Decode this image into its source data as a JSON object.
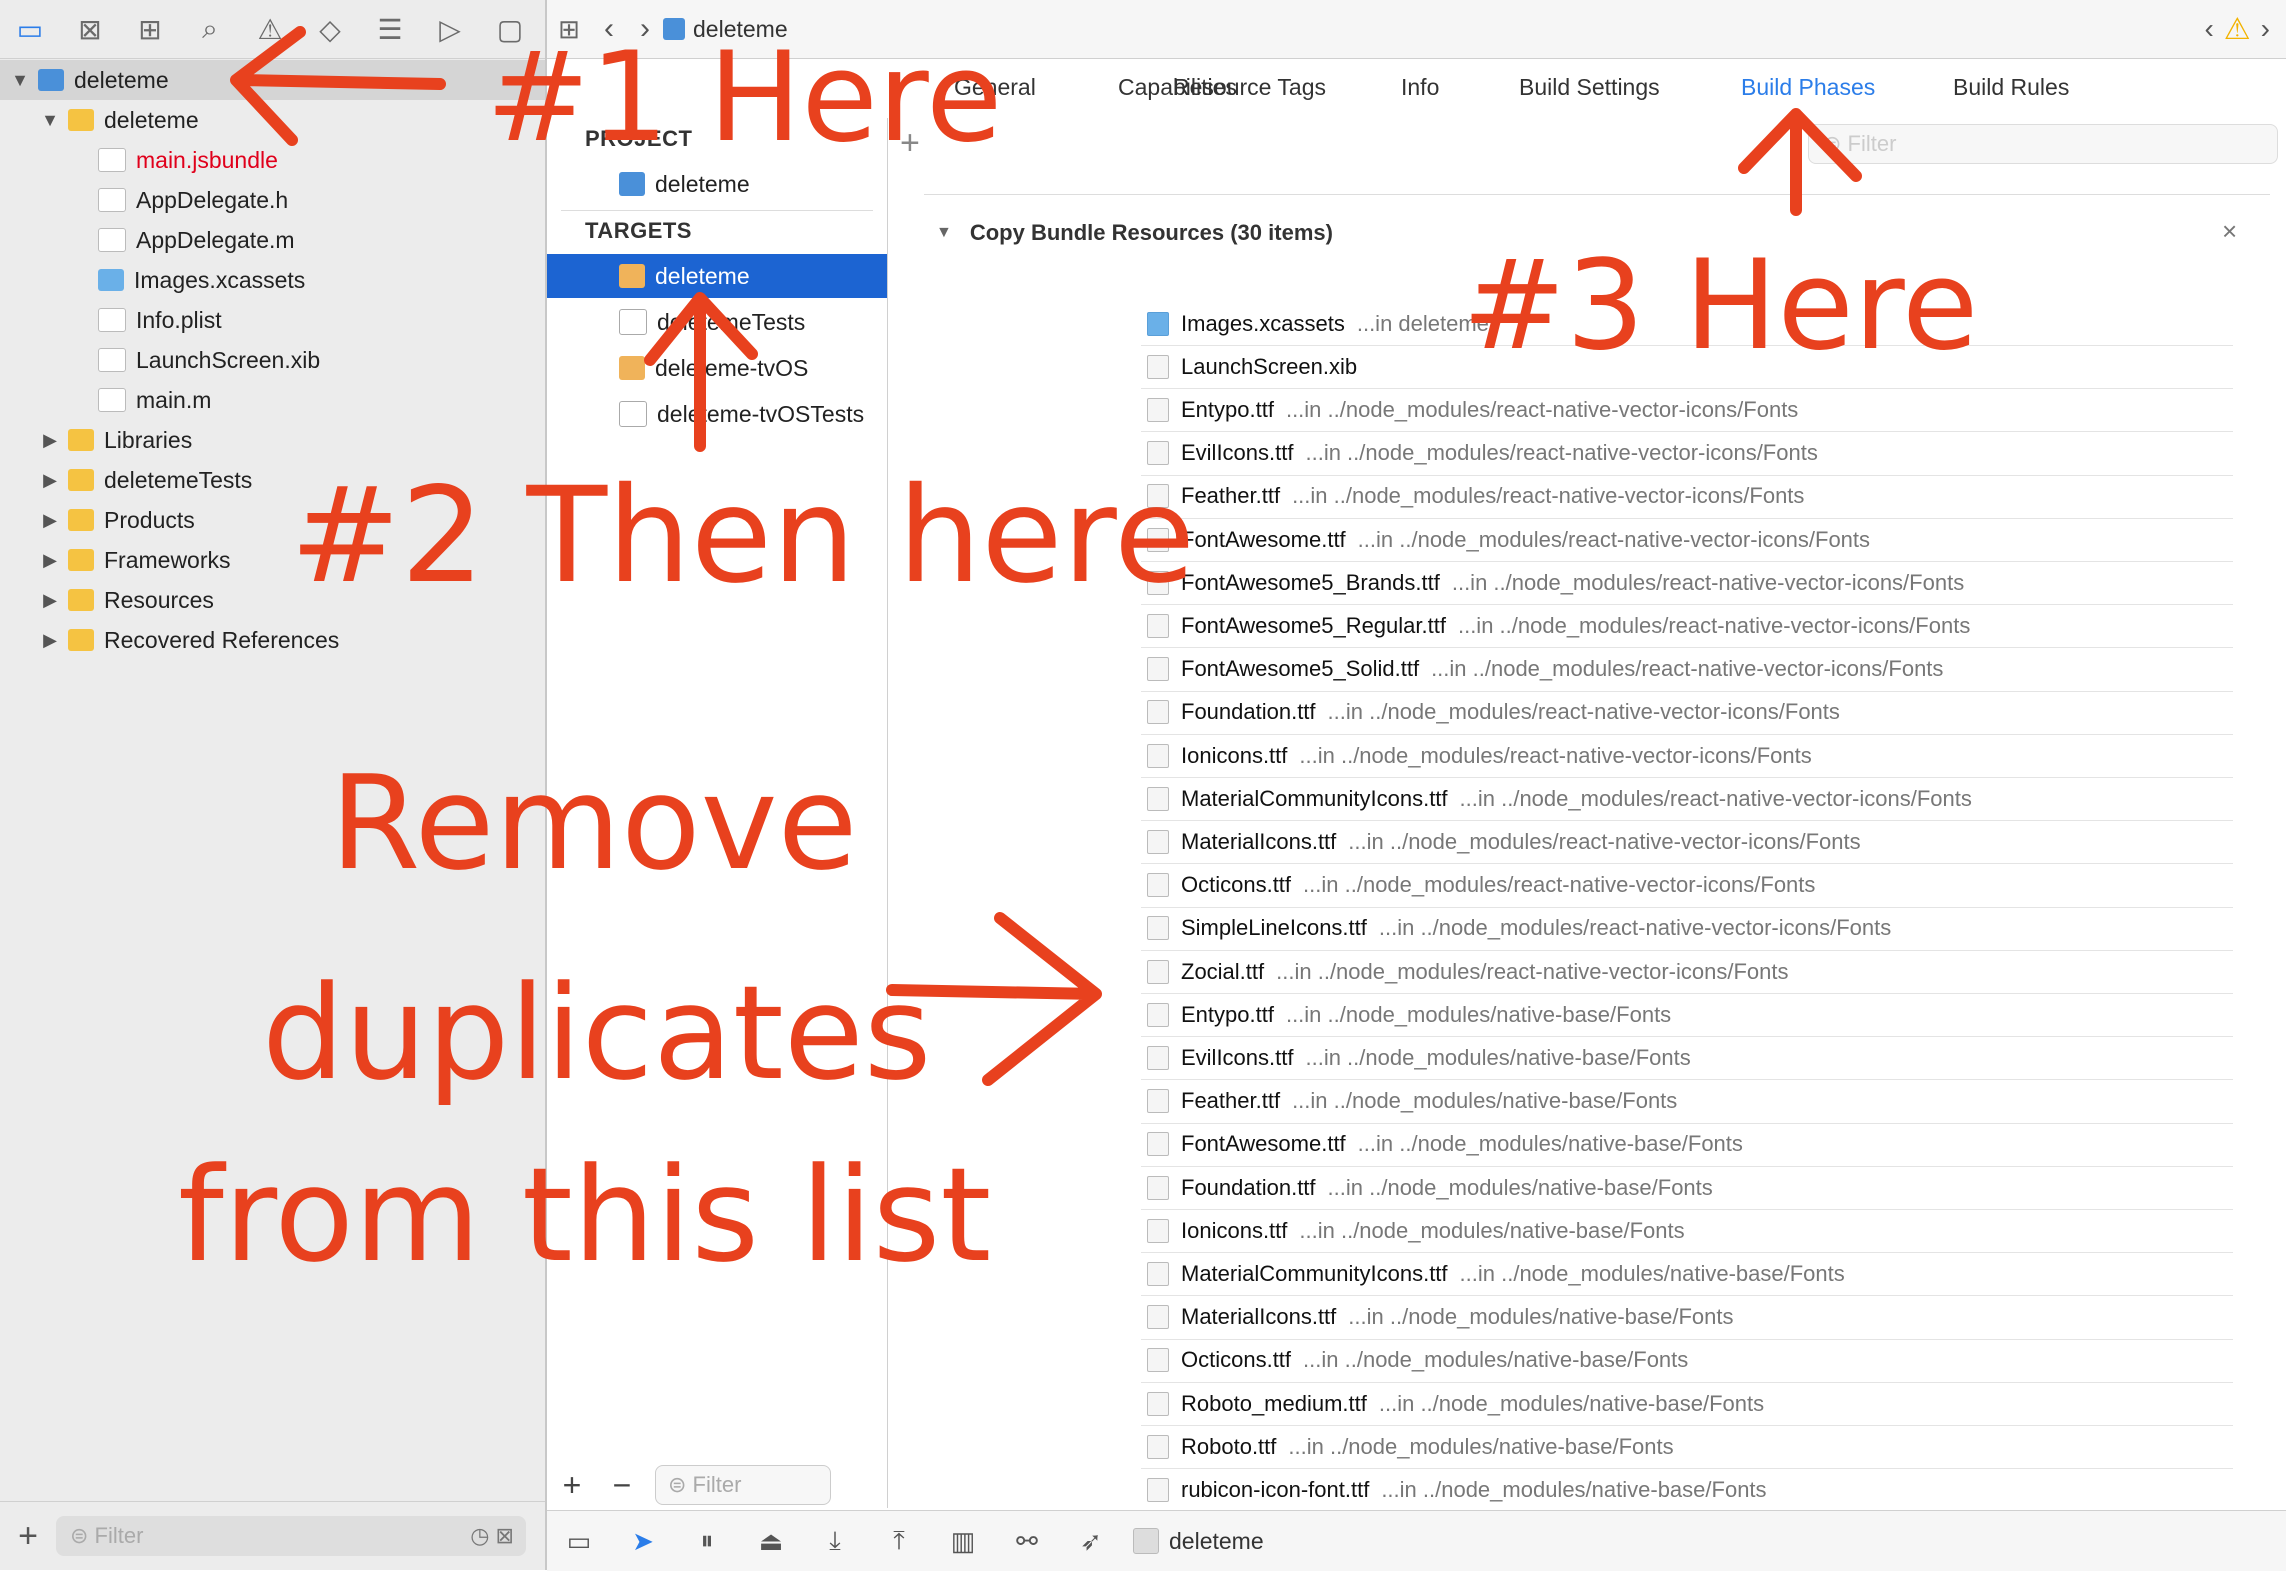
{
  "navigator": {
    "toolbar_icons": [
      "folder-icon",
      "x-square-icon",
      "hierarchy-icon",
      "search-icon",
      "warning-icon",
      "diamond-icon",
      "list-icon",
      "tag-icon",
      "comment-icon"
    ],
    "tree": [
      {
        "label": "deleteme",
        "kind": "project",
        "depth": 0,
        "disclosure": "▼",
        "selected": true
      },
      {
        "label": "deleteme",
        "kind": "folder",
        "depth": 1,
        "disclosure": "▼"
      },
      {
        "label": "main.jsbundle",
        "kind": "doc",
        "depth": 2,
        "disclosure": "",
        "red": true
      },
      {
        "label": "AppDelegate.h",
        "kind": "doc",
        "depth": 2,
        "disclosure": ""
      },
      {
        "label": "AppDelegate.m",
        "kind": "doc",
        "depth": 2,
        "disclosure": ""
      },
      {
        "label": "Images.xcassets",
        "kind": "assets",
        "depth": 2,
        "disclosure": ""
      },
      {
        "label": "Info.plist",
        "kind": "doc",
        "depth": 2,
        "disclosure": ""
      },
      {
        "label": "LaunchScreen.xib",
        "kind": "doc",
        "depth": 2,
        "disclosure": ""
      },
      {
        "label": "main.m",
        "kind": "doc",
        "depth": 2,
        "disclosure": ""
      },
      {
        "label": "Libraries",
        "kind": "folder",
        "depth": 1,
        "disclosure": "▶"
      },
      {
        "label": "deletemeTests",
        "kind": "folder",
        "depth": 1,
        "disclosure": "▶"
      },
      {
        "label": "Products",
        "kind": "folder",
        "depth": 1,
        "disclosure": "▶"
      },
      {
        "label": "Frameworks",
        "kind": "folder",
        "depth": 1,
        "disclosure": "▶"
      },
      {
        "label": "Resources",
        "kind": "folder",
        "depth": 1,
        "disclosure": "▶"
      },
      {
        "label": "Recovered References",
        "kind": "folder",
        "depth": 1,
        "disclosure": "▶"
      }
    ],
    "filter_placeholder": "Filter"
  },
  "editor": {
    "breadcrumb": "deleteme",
    "tabs": [
      "General",
      "Capabilities",
      "Resource Tags",
      "Info",
      "Build Settings",
      "Build Phases",
      "Build Rules"
    ],
    "active_tab": "Build Phases",
    "project_header": "PROJECT",
    "project_item": "deleteme",
    "targets_header": "TARGETS",
    "targets": [
      "deleteme",
      "deletemeTests",
      "deleteme-tvOS",
      "deleteme-tvOSTests"
    ],
    "selected_target": "deleteme",
    "filter_placeholder": "Filter",
    "list_filter_placeholder": "Filter"
  },
  "phase": {
    "title": "Copy Bundle Resources (30 items)",
    "resources": [
      {
        "name": "Images.xcassets",
        "loc": "...in deleteme",
        "folder": true
      },
      {
        "name": "LaunchScreen.xib",
        "loc": ""
      },
      {
        "name": "Entypo.ttf",
        "loc": "...in ../node_modules/react-native-vector-icons/Fonts"
      },
      {
        "name": "EvilIcons.ttf",
        "loc": "...in ../node_modules/react-native-vector-icons/Fonts"
      },
      {
        "name": "Feather.ttf",
        "loc": "...in ../node_modules/react-native-vector-icons/Fonts"
      },
      {
        "name": "FontAwesome.ttf",
        "loc": "...in ../node_modules/react-native-vector-icons/Fonts"
      },
      {
        "name": "FontAwesome5_Brands.ttf",
        "loc": "...in ../node_modules/react-native-vector-icons/Fonts"
      },
      {
        "name": "FontAwesome5_Regular.ttf",
        "loc": "...in ../node_modules/react-native-vector-icons/Fonts"
      },
      {
        "name": "FontAwesome5_Solid.ttf",
        "loc": "...in ../node_modules/react-native-vector-icons/Fonts"
      },
      {
        "name": "Foundation.ttf",
        "loc": "...in ../node_modules/react-native-vector-icons/Fonts"
      },
      {
        "name": "Ionicons.ttf",
        "loc": "...in ../node_modules/react-native-vector-icons/Fonts"
      },
      {
        "name": "MaterialCommunityIcons.ttf",
        "loc": "...in ../node_modules/react-native-vector-icons/Fonts"
      },
      {
        "name": "MaterialIcons.ttf",
        "loc": "...in ../node_modules/react-native-vector-icons/Fonts"
      },
      {
        "name": "Octicons.ttf",
        "loc": "...in ../node_modules/react-native-vector-icons/Fonts"
      },
      {
        "name": "SimpleLineIcons.ttf",
        "loc": "...in ../node_modules/react-native-vector-icons/Fonts"
      },
      {
        "name": "Zocial.ttf",
        "loc": "...in ../node_modules/react-native-vector-icons/Fonts"
      },
      {
        "name": "Entypo.ttf",
        "loc": "...in ../node_modules/native-base/Fonts"
      },
      {
        "name": "EvilIcons.ttf",
        "loc": "...in ../node_modules/native-base/Fonts"
      },
      {
        "name": "Feather.ttf",
        "loc": "...in ../node_modules/native-base/Fonts"
      },
      {
        "name": "FontAwesome.ttf",
        "loc": "...in ../node_modules/native-base/Fonts"
      },
      {
        "name": "Foundation.ttf",
        "loc": "...in ../node_modules/native-base/Fonts"
      },
      {
        "name": "Ionicons.ttf",
        "loc": "...in ../node_modules/native-base/Fonts"
      },
      {
        "name": "MaterialCommunityIcons.ttf",
        "loc": "...in ../node_modules/native-base/Fonts"
      },
      {
        "name": "MaterialIcons.ttf",
        "loc": "...in ../node_modules/native-base/Fonts"
      },
      {
        "name": "Octicons.ttf",
        "loc": "...in ../node_modules/native-base/Fonts"
      },
      {
        "name": "Roboto_medium.ttf",
        "loc": "...in ../node_modules/native-base/Fonts"
      },
      {
        "name": "Roboto.ttf",
        "loc": "...in ../node_modules/native-base/Fonts"
      },
      {
        "name": "rubicon-icon-font.ttf",
        "loc": "...in ../node_modules/native-base/Fonts"
      }
    ]
  },
  "debug_bar": {
    "scheme": "deleteme"
  },
  "annotations": {
    "step1": "#1 Here",
    "step2": "#2 Then here",
    "step3": "#3 Here",
    "remove_line1": "Remove",
    "remove_line2": "duplicates",
    "remove_line3": "from this list",
    "color": "#e8411e"
  },
  "colors": {
    "accent": "#2b7de9",
    "selection": "#1c64d2",
    "folder": "#f5c342",
    "warning": "#f2b300",
    "error_text": "#e0001b"
  }
}
